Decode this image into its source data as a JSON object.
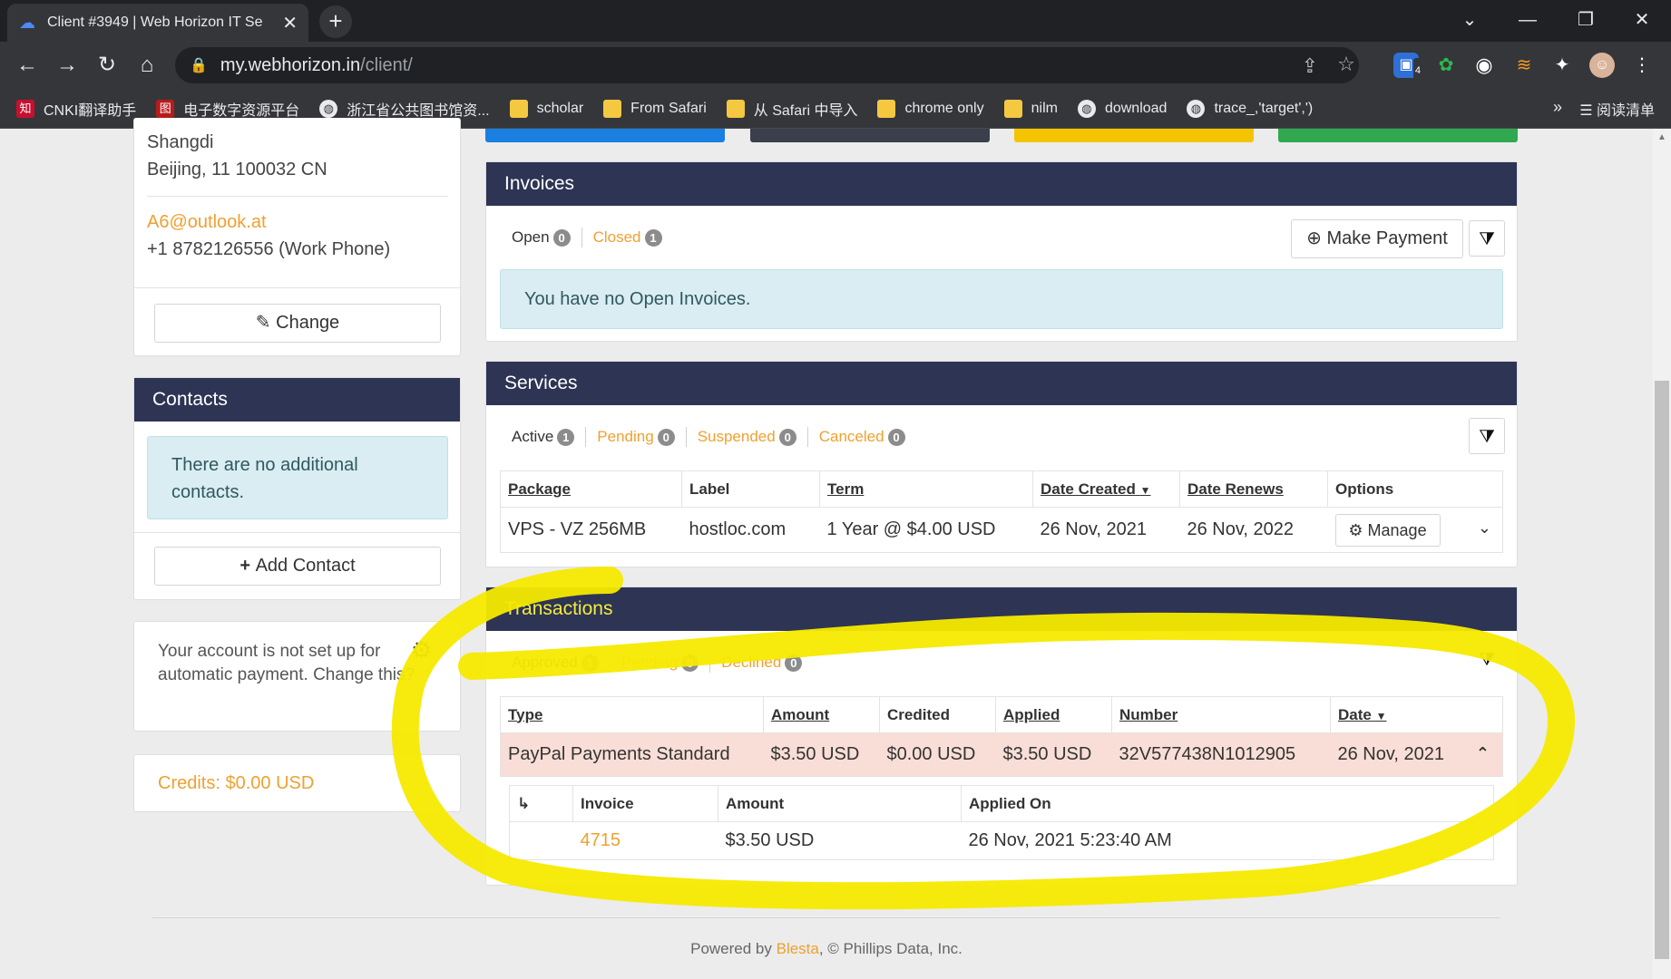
{
  "browser": {
    "tab_title": "Client #3949 | Web Horizon IT Se",
    "url_host": "my.webhorizon.in",
    "url_path": "/client/",
    "extension_badge": "4",
    "bookmarks": [
      {
        "label": "CNKI翻译助手",
        "icon": "cnki-icon"
      },
      {
        "label": "电子数字资源平台",
        "icon": "library-icon"
      },
      {
        "label": "浙江省公共图书馆资...",
        "icon": "globe-icon"
      },
      {
        "label": "scholar",
        "icon": "folder-icon"
      },
      {
        "label": "From Safari",
        "icon": "folder-icon"
      },
      {
        "label": "从 Safari 中导入",
        "icon": "folder-icon"
      },
      {
        "label": "chrome only",
        "icon": "folder-icon"
      },
      {
        "label": "nilm",
        "icon": "folder-icon"
      },
      {
        "label": "download",
        "icon": "globe-icon"
      },
      {
        "label": "trace_,'target',')",
        "icon": "globe-icon"
      }
    ],
    "more_bookmarks": "»",
    "reading_list": "阅读清单"
  },
  "sidebar": {
    "address_line1": "Shangdi",
    "address_line2": "Beijing, 11 100032 CN",
    "email": "A6@outlook.at",
    "phone": "+1 8782126556 (Work Phone)",
    "change_button": "Change",
    "contacts_title": "Contacts",
    "contacts_empty": "There are no additional contacts.",
    "add_contact_button": "Add Contact",
    "autopay_text": "Your account is not set up for automatic payment. Change this?",
    "credits": "Credits: $0.00 USD"
  },
  "invoices": {
    "title": "Invoices",
    "tab_open": "Open",
    "tab_open_count": "0",
    "tab_closed": "Closed",
    "tab_closed_count": "1",
    "make_payment": "Make Payment",
    "empty_message": "You have no Open Invoices."
  },
  "services": {
    "title": "Services",
    "tabs": [
      {
        "label": "Active",
        "count": "1"
      },
      {
        "label": "Pending",
        "count": "0"
      },
      {
        "label": "Suspended",
        "count": "0"
      },
      {
        "label": "Canceled",
        "count": "0"
      }
    ],
    "columns": [
      "Package",
      "Label",
      "Term",
      "Date Created",
      "Date Renews",
      "Options"
    ],
    "row": {
      "package": "VPS - VZ 256MB",
      "label": "hostloc.com",
      "term": "1 Year @ $4.00 USD",
      "date_created": "26 Nov, 2021",
      "date_renews": "26 Nov, 2022",
      "manage": "Manage"
    }
  },
  "transactions": {
    "title": "Transactions",
    "tabs": [
      {
        "label": "Approved",
        "count": "1"
      },
      {
        "label": "Pending",
        "count": "0"
      },
      {
        "label": "Declined",
        "count": "0"
      }
    ],
    "columns": [
      "Type",
      "Amount",
      "Credited",
      "Applied",
      "Number",
      "Date"
    ],
    "row": {
      "type": "PayPal Payments Standard",
      "amount": "$3.50 USD",
      "credited": "$0.00 USD",
      "applied": "$3.50 USD",
      "number": "32V577438N1012905",
      "date": "26 Nov, 2021"
    },
    "sub_columns": [
      "Invoice",
      "Amount",
      "Applied On"
    ],
    "sub_row": {
      "invoice": "4715",
      "amount": "$3.50 USD",
      "applied_on": "26 Nov, 2021 5:23:40 AM"
    }
  },
  "footer": {
    "prefix": "Powered by ",
    "brand": "Blesta",
    "suffix": ", © Phillips Data, Inc."
  },
  "colors": {
    "header_navy": "#2e3453",
    "link_orange": "#f0a030",
    "highlight_row": "#f9ded7",
    "annotation_yellow": "#f5ea00"
  }
}
